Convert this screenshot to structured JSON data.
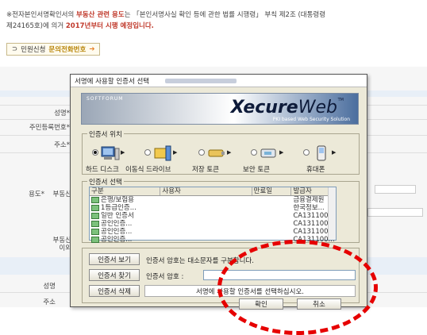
{
  "background": {
    "notice_line1_a": "※전자본인서명확인서의 ",
    "notice_em1": "부동산 관련 용도",
    "notice_line1_b": "는 「본인서명사실 확인 등에 관한 법률 시행령」 부칙 제2조 (대통령령",
    "notice_line2_a": "제24165호)에 의거 ",
    "notice_em2": "2017년부터 시행 예정입니다.",
    "button_left": "민원신청",
    "button_link": "문의전화번호",
    "labels": {
      "name": "성명*",
      "resident_number": "주민등록번호*",
      "address": "주소*",
      "purpose": "용도*",
      "real_estate": "부동산",
      "real_estate2": "부동산",
      "other": "이외",
      "name2": "성명",
      "address2": "주소"
    }
  },
  "dialog": {
    "title": "서명에 사용할 인증서 선택",
    "banner": {
      "brand_small": "SOFTFORUM",
      "logo_bold": "Xecure",
      "logo_light": "Web",
      "trademark": "TM",
      "subtitle": "PKI based Web Security Solution"
    },
    "location_group": {
      "title": "인증서 위치",
      "devices": [
        {
          "label": "하드 디스크",
          "icon": "hard-disk-icon",
          "selected": true
        },
        {
          "label": "이동식 드라이브",
          "icon": "removable-drive-icon",
          "selected": false
        },
        {
          "label": "저장 토큰",
          "icon": "storage-token-icon",
          "selected": false
        },
        {
          "label": "보안 토큰",
          "icon": "security-token-icon",
          "selected": false
        },
        {
          "label": "휴대폰",
          "icon": "mobile-phone-icon",
          "selected": false
        }
      ]
    },
    "cert_group": {
      "title": "인증서 선택",
      "columns": [
        "구분",
        "사용자",
        "만료일",
        "발급자"
      ],
      "rows": [
        [
          "은행/보험용",
          "",
          "",
          "금융결제원"
        ],
        [
          "1등급인증...",
          "",
          "",
          "한국정보..."
        ],
        [
          "일반 인증서",
          "",
          "",
          "CA131100..."
        ],
        [
          "공인인증...",
          "",
          "",
          "CA131100..."
        ],
        [
          "공인인증...",
          "",
          "",
          "CA131100..."
        ],
        [
          "공인인증...",
          "",
          "",
          "CA131100..."
        ]
      ]
    },
    "actions": {
      "view_button": "인증서 보기",
      "view_hint": "인증서 암호는 대소문자를 구분합니다.",
      "find_button": "인증서 찾기",
      "password_label": "인증서 암호 :",
      "password_value": "",
      "delete_button": "인증서 삭제",
      "status_text": "서명에 사용할 인증서를 선택하십시오.",
      "ok_button": "확인",
      "cancel_button": "취소"
    }
  },
  "colors": {
    "annotation": "#e60000",
    "accent_link": "#b8860b",
    "notice_emphasis": "#c0392b"
  }
}
